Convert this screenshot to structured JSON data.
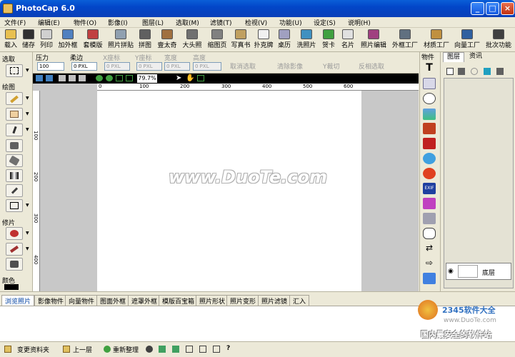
{
  "window": {
    "title": "PhotoCap 6.0",
    "minimize": "_",
    "maximize": "□",
    "close": "×"
  },
  "menu": [
    "文件(F)",
    "编辑(E)",
    "物件(O)",
    "影像(I)",
    "图层(L)",
    "选取(M)",
    "滤镜(T)",
    "检视(V)",
    "功能(U)",
    "设定(S)",
    "说明(H)"
  ],
  "toolbar": [
    "载入",
    "储存",
    "列印",
    "加外框",
    "套模版",
    "照片拼贴",
    "拼图",
    "壹太奇",
    "大头照",
    "缩图页",
    "写真书",
    "扑克牌",
    "桌历",
    "洗照片",
    "贺卡",
    "名片",
    "照片编辑",
    "外框工厂",
    "材质工厂",
    "向量工厂",
    "批次功能"
  ],
  "options": {
    "pressure_label": "压力",
    "pressure_value": "100",
    "feather_label": "柔边",
    "feather_value": "0 PXL",
    "x_label": "X座标",
    "x_value": "0 PXL",
    "y_label": "Y座标",
    "y_value": "0 PXL",
    "width_label": "宽度",
    "width_value": "0 PXL",
    "height_label": "高度",
    "height_value": "0 PXL",
    "cancel_select": "取消选取",
    "clear_image": "清除影像",
    "cut": "Y裁切",
    "invert": "反相选取"
  },
  "left_panel": {
    "select": "选取",
    "draw": "绘图",
    "repair": "修片",
    "color": "颜色"
  },
  "view": {
    "zoom": "79.7%"
  },
  "ruler": {
    "top": [
      "0",
      "100",
      "200",
      "300",
      "400",
      "500",
      "600"
    ],
    "left": [
      "100",
      "200",
      "300",
      "400"
    ]
  },
  "right_panel": {
    "objects_title": "物件",
    "tab_layers": "图层",
    "tab_info": "资讯",
    "base_layer": "底层"
  },
  "bottom_tabs": [
    "浏览照片",
    "影像物件",
    "向量物件",
    "图面外框",
    "遮罩外框",
    "模版百宝箱",
    "照片形状",
    "照片变形",
    "照片滤镜",
    "汇入"
  ],
  "status": {
    "change_folder": "变更资料夹",
    "up_level": "上一层",
    "refresh": "重新整理"
  },
  "watermark": "www.DuoTe.com",
  "logo": {
    "brand": "2345软件大全",
    "url": "www.DuoTe.com",
    "slogan": "国内最安全的软件站"
  }
}
